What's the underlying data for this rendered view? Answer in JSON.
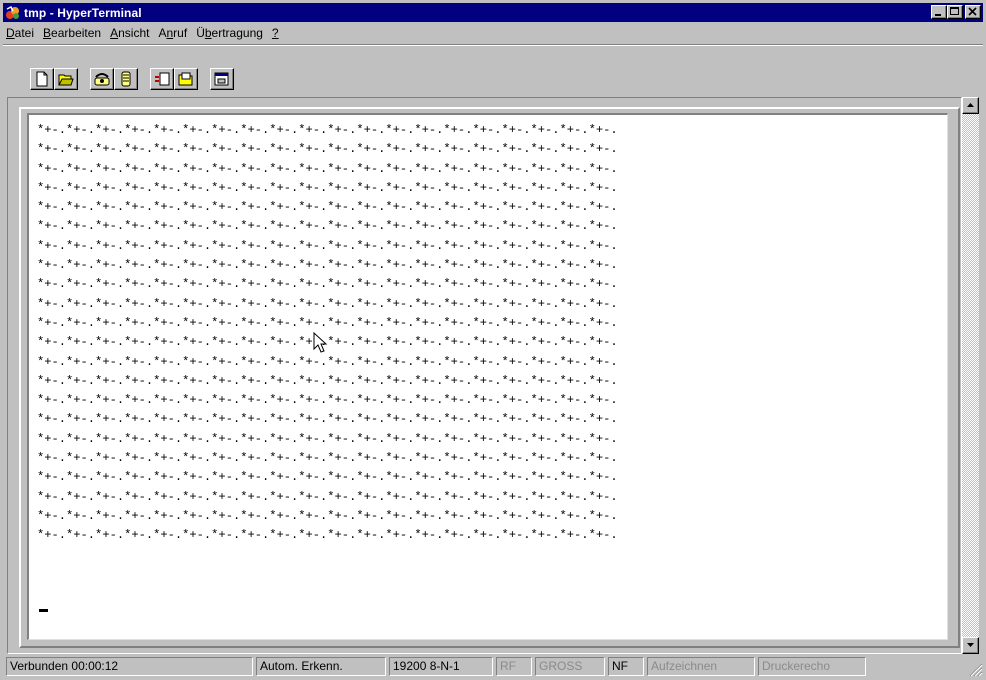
{
  "window": {
    "title": "tmp - HyperTerminal",
    "controls": [
      "minimize-icon",
      "maximize-icon",
      "close-icon"
    ]
  },
  "menu": {
    "items": [
      {
        "label_u": "D",
        "label_rest": "atei"
      },
      {
        "label_u": "B",
        "label_rest": "earbeiten"
      },
      {
        "label_u": "A",
        "label_rest": "nsicht"
      },
      {
        "label_pre": "A",
        "label_u": "n",
        "label_rest": "ruf"
      },
      {
        "label_pre": "Ü",
        "label_u": "b",
        "label_rest": "ertragung"
      },
      {
        "label_u": "?",
        "label_rest": ""
      }
    ]
  },
  "toolbar": {
    "buttons": [
      "new-icon",
      "open-icon",
      "connect-icon",
      "disconnect-icon",
      "send-icon",
      "receive-icon",
      "properties-icon"
    ]
  },
  "terminal": {
    "pattern": "*+-.",
    "repeat_per_line": 20,
    "line_count": 22,
    "cursor": "_"
  },
  "status": {
    "connection": "Verbunden 00:00:12",
    "detect": "Autom. Erkenn.",
    "port_settings": "19200 8-N-1",
    "rf": "RF",
    "gross": "GROSS",
    "nf": "NF",
    "capture": "Aufzeichnen",
    "print_echo": "Druckerecho"
  }
}
